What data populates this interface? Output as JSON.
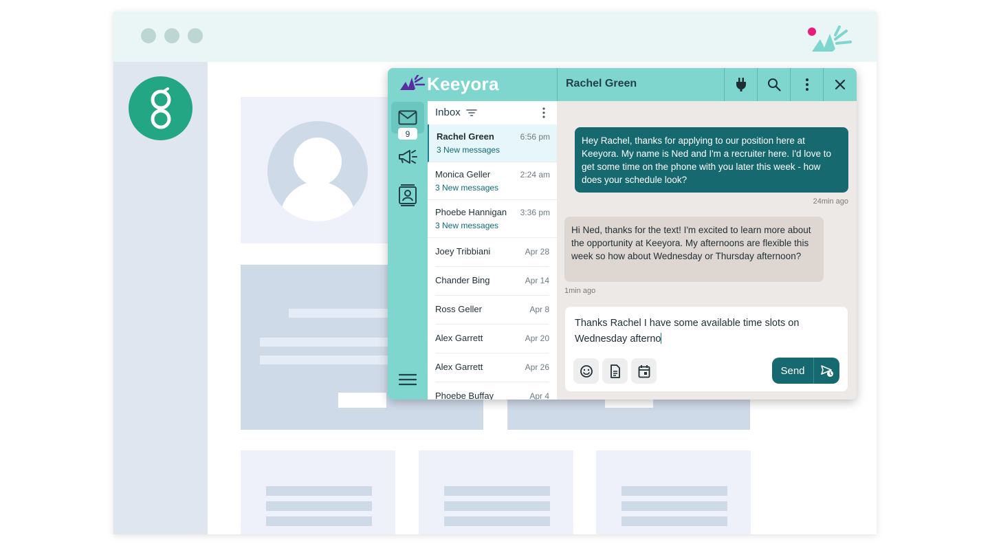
{
  "widget": {
    "logo_text": "Keeyora",
    "contact_name": "Rachel Green",
    "inbox_badge": "9"
  },
  "inbox": {
    "title": "Inbox",
    "conversations": [
      {
        "name": "Rachel Green",
        "time": "6:56 pm",
        "sub": "3 New messages"
      },
      {
        "name": "Monica Geller",
        "time": "2:24 am",
        "sub": "3 New messages"
      },
      {
        "name": "Phoebe Hannigan",
        "time": "3:36 pm",
        "sub": "3 New messages"
      },
      {
        "name": "Joey Tribbiani",
        "time": "Apr 28"
      },
      {
        "name": "Chander Bing",
        "time": "Apr 14"
      },
      {
        "name": "Ross Geller",
        "time": "Apr 8"
      },
      {
        "name": "Alex Garrett",
        "time": "Apr 20"
      },
      {
        "name": "Alex Garrett",
        "time": "Apr 26"
      },
      {
        "name": "Phoebe Buffay",
        "time": "Apr 4"
      }
    ]
  },
  "chat": {
    "outgoing_text": "Hey Rachel, thanks for applying to our position here at Keeyora. My name is Ned and I'm a recruiter here. I'd love to get some time on the phone with you later this week - how does your schedule look?",
    "outgoing_time": "24min ago",
    "incoming_text": "Hi Ned, thanks for the text! I'm excited to learn more about the opportunity at Keeyora. My afternoons are flexible this week so how about Wednesday or Thursday afternoon?",
    "incoming_time": "1min ago"
  },
  "composer": {
    "draft": "Thanks Rachel I have some available time slots on Wednesday afterno",
    "send_label": "Send"
  },
  "colors": {
    "teal": "#7ed6cf",
    "dark_teal": "#16696f",
    "accent_pink": "#ec1a7b",
    "host_green": "#23a683"
  },
  "icons": {
    "header": [
      "plug-icon",
      "search-icon",
      "more-vertical-icon",
      "close-icon"
    ],
    "sidebar": [
      "mail-icon",
      "megaphone-icon",
      "contacts-icon",
      "menu-icon"
    ],
    "composer": [
      "emoji-icon",
      "document-icon",
      "calendar-icon",
      "schedule-send-icon"
    ]
  }
}
